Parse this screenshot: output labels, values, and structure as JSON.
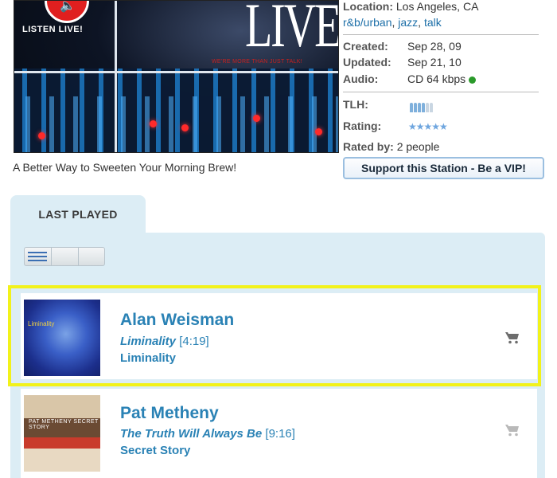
{
  "banner": {
    "listen_text": "LISTEN LIVE!",
    "live_text": "LIVE!",
    "tagline": "WE'RE MORE THAN JUST TALK!"
  },
  "caption": "A Better Way to Sweeten Your Morning Brew!",
  "info": {
    "location_label": "Location:",
    "location_value": "Los Angeles, CA",
    "genres": [
      "r&b/urban",
      "jazz",
      "talk"
    ],
    "created_label": "Created:",
    "created_value": "Sep 28, 09",
    "updated_label": "Updated:",
    "updated_value": "Sep 21, 10",
    "audio_label": "Audio:",
    "audio_value": "CD 64 kbps",
    "status_color": "#2a9a2a",
    "tlh_label": "TLH:",
    "tlh_level": 4,
    "tlh_max": 6,
    "rating_label": "Rating:",
    "rating_stars": 5,
    "rated_by_label": "Rated by:",
    "rated_by_value": "2 people",
    "vip_button": "Support this Station - Be a VIP!"
  },
  "last_played": {
    "tab_label": "LAST PLAYED",
    "tracks": [
      {
        "artist": "Alan Weisman",
        "title": "Liminality",
        "duration": "[4:19]",
        "album": "Liminality",
        "art_text": "Liminality",
        "highlighted": true
      },
      {
        "artist": "Pat Metheny",
        "title": "The Truth Will Always Be",
        "duration": "[9:16]",
        "album": "Secret Story",
        "art_text": "PAT METHENY SECRET STORY",
        "highlighted": false
      }
    ]
  },
  "colors": {
    "accent": "#2a82b5",
    "panel": "#dcedf5",
    "highlight": "#f2f21a"
  }
}
